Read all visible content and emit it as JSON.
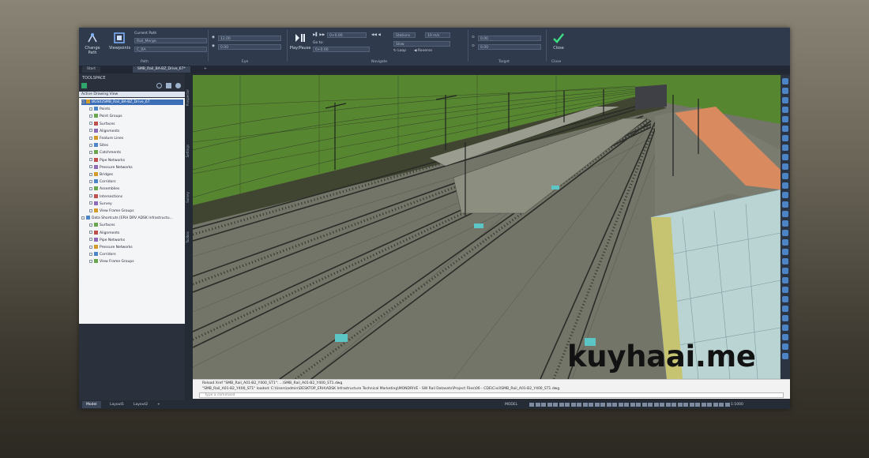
{
  "ribbon": {
    "path_group": {
      "change_path": "Change Path",
      "viewpoints": "Viewpoints",
      "current_path_label": "Current Path",
      "path_name": "Rail_Merge",
      "path_sub": "C_RA",
      "caption": "Path"
    },
    "eye_group": {
      "eye_field_1": "12.00",
      "eye_field_2": "0.00",
      "caption": "Eye"
    },
    "navigate_group": {
      "play_label": "Play/Pause",
      "go_to": "Go to:",
      "go_value": "0+0.00",
      "station": "0+0.00",
      "speed": "1x Speed",
      "slow": "Slow",
      "loop": "Loop",
      "reverse": "Reverse",
      "mode": "Stations",
      "length": "10 m/s",
      "caption": "Navigate"
    },
    "target_group": {
      "target_1": "0.00",
      "target_2": "0.00",
      "caption": "Target"
    },
    "close_group": {
      "close_label": "Close",
      "caption": "Close"
    }
  },
  "doc_tabs": [
    {
      "label": "Start"
    },
    {
      "label": "SMB_Rail_BA-BZ_Drive_67*"
    }
  ],
  "palette": {
    "title": "TOOLSPACE",
    "view_selector": "Active Drawing View",
    "tree": [
      {
        "label": "BGS02SMB_Rail_BA-BZ_Drive_67",
        "level": 0,
        "root": true
      },
      {
        "label": "Points",
        "level": 1
      },
      {
        "label": "Point Groups",
        "level": 1
      },
      {
        "label": "Surfaces",
        "level": 1
      },
      {
        "label": "Alignments",
        "level": 1
      },
      {
        "label": "Feature Lines",
        "level": 1
      },
      {
        "label": "Sites",
        "level": 1
      },
      {
        "label": "Catchments",
        "level": 1
      },
      {
        "label": "Pipe Networks",
        "level": 1
      },
      {
        "label": "Pressure Networks",
        "level": 1
      },
      {
        "label": "Bridges",
        "level": 1
      },
      {
        "label": "Corridors",
        "level": 1
      },
      {
        "label": "Assemblies",
        "level": 1
      },
      {
        "label": "Intersections",
        "level": 1
      },
      {
        "label": "Survey",
        "level": 1
      },
      {
        "label": "View Frame Groups",
        "level": 1
      },
      {
        "label": "Data Shortcuts [ERH DRV ADSK Infrastructu...",
        "level": 0
      },
      {
        "label": "Surfaces",
        "level": 1
      },
      {
        "label": "Alignments",
        "level": 1
      },
      {
        "label": "Pipe Networks",
        "level": 1
      },
      {
        "label": "Pressure Networks",
        "level": 1
      },
      {
        "label": "Corridors",
        "level": 1
      },
      {
        "label": "View Frame Groups",
        "level": 1
      }
    ],
    "side_tabs": [
      "Prospector",
      "Settings",
      "Survey",
      "Toolbox"
    ]
  },
  "command_line": {
    "lines": [
      "Reload Xref \"SMB_Rail_A01-B2_Y400_ST1\": ...\\SMB_Rail_A01-B2_Y400_ST1.dwg",
      "\"SMB_Rail_A01-B2_Y400_ST1\" loaded: C:\\Users\\admin\\DESKTOP_ERH\\ADSK Infrastructure Technical Marketing\\MONDRIVE - SW Rail Datasets\\Project Files\\06 - CDE\\Civil\\SMB_Rail_A01-B2_Y400_ST1.dwg"
    ],
    "prompt_placeholder": "Type a command"
  },
  "status_bar": {
    "layout_tabs": [
      {
        "label": "Model"
      },
      {
        "label": "Layout1"
      },
      {
        "label": "Layout2"
      }
    ],
    "add_tab": "+",
    "model_label": "MODEL",
    "scale": "1:1000"
  },
  "watermark": {
    "text": "kuyhaai.me"
  },
  "colors": {
    "ribbon": "#2f3a4c",
    "ground": "#5c6e26",
    "ballast": "#7c7f72",
    "platform_orange": "#d98a5f",
    "accent_blue": "#3c6fb6"
  }
}
